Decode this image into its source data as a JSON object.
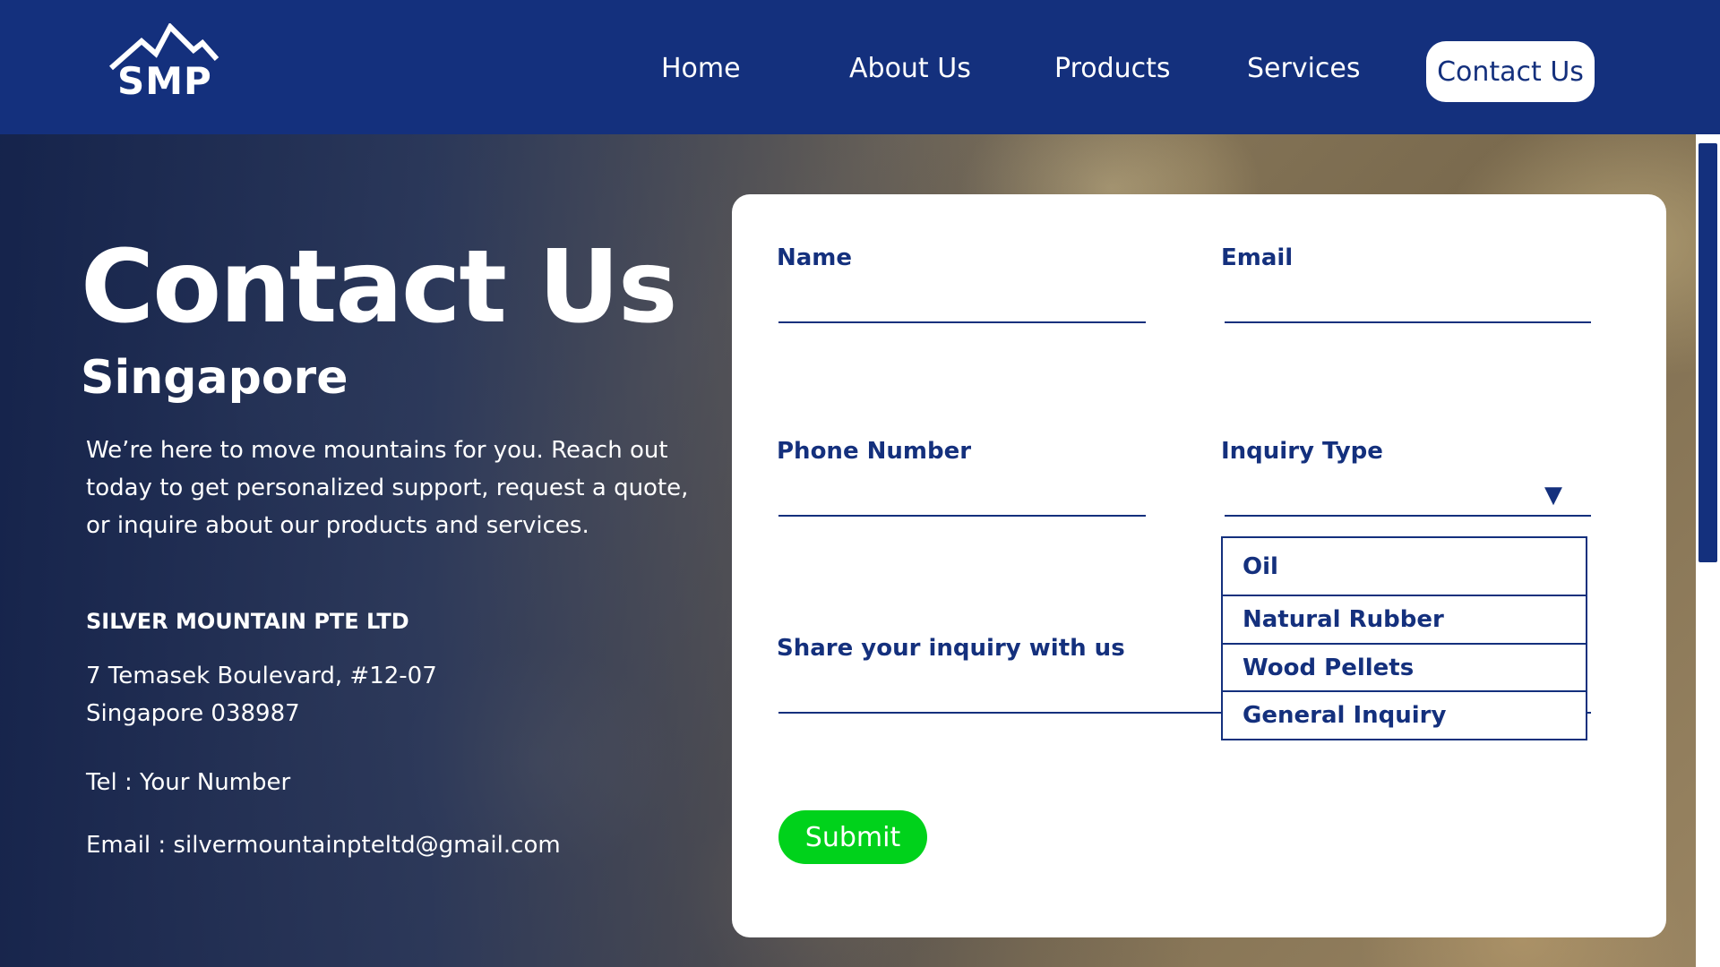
{
  "brand": {
    "logo_text": "SMP"
  },
  "nav": {
    "items": [
      "Home",
      "About Us",
      "Products",
      "Services"
    ],
    "active": "Contact Us"
  },
  "hero": {
    "title": "Contact Us",
    "subtitle": "Singapore",
    "intro": "We’re here to move mountains for you. Reach out today to get personalized support, request a quote, or inquire about our products and services.",
    "company": "SILVER MOUNTAIN PTE LTD",
    "address_line1": "7 Temasek Boulevard, #12-07",
    "address_line2": "Singapore 038987",
    "tel": "Tel : Your Number",
    "email": "Email : silvermountainpteltd@gmail.com"
  },
  "form": {
    "name_label": "Name",
    "name_value": "",
    "email_label": "Email",
    "email_value": "",
    "phone_label": "Phone Number",
    "phone_value": "",
    "inquiry_type_label": "Inquiry Type",
    "inquiry_type_value": "",
    "inquiry_options": [
      "Oil",
      "Natural Rubber",
      "Wood Pellets",
      "General Inquiry"
    ],
    "message_label": "Share your inquiry with us",
    "message_value": "",
    "submit_label": "Submit"
  },
  "colors": {
    "primary": "#14307d",
    "submit": "#00d21b",
    "text_light": "#ffffff"
  },
  "icons": {
    "logo": "mountain-logo-icon",
    "select": "triangle-down-icon"
  }
}
